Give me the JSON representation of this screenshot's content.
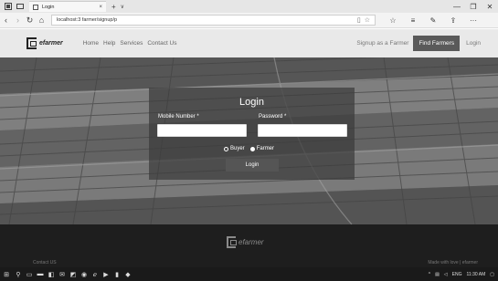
{
  "browser": {
    "tab_title": "Login",
    "tab_close": "×",
    "new_tab": "+",
    "tab_dropdown": "∨",
    "url": "localhost:3 farmer/signup/p",
    "window_controls": [
      "—",
      "❐",
      "✕"
    ],
    "nav": {
      "back": "‹",
      "forward": "›",
      "refresh": "↻",
      "home": "⌂"
    },
    "toolbar_icons": [
      "star-icon",
      "favorites-icon",
      "pen-icon",
      "share-icon",
      "more-icon"
    ],
    "toolbar_glyphs": [
      "☆",
      "≡",
      "✎",
      "⇪",
      "···"
    ]
  },
  "header": {
    "logo": "efarmer",
    "menu": [
      "Home",
      "Help",
      "Services",
      "Contact Us"
    ],
    "signup": "Signup as a Farmer",
    "find_farmers": "Find Farmers",
    "login": "Login"
  },
  "login": {
    "title": "Login",
    "mobile_label": "Mobile Number *",
    "mobile_value": "",
    "password_label": "Password *",
    "password_value": "",
    "roles": [
      "Buyer",
      "Farmer"
    ],
    "selected_role": "Farmer",
    "submit": "Login"
  },
  "footer": {
    "logo": "efarmer",
    "contact": "Contact US",
    "right": "Made with love | efarmer"
  },
  "taskbar": {
    "icons": [
      "windows-start-icon",
      "search-icon",
      "task-view-icon",
      "file-explorer-icon",
      "store-icon",
      "mail-icon",
      "photos-icon",
      "chrome-icon",
      "edge-icon",
      "media-icon",
      "terminal-icon",
      "app-icon"
    ],
    "lang": "ENG",
    "time": "11:30 AM"
  },
  "colors": {
    "header_bg": "#e9e9e9",
    "find_farmers_bg": "#5a5a5a",
    "footer_bg": "#1e1e1e",
    "taskbar_bg": "#1a1a1a"
  }
}
